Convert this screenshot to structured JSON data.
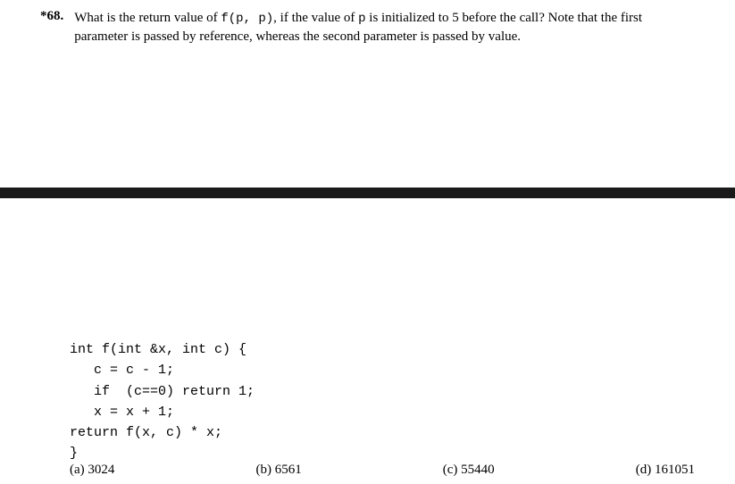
{
  "question": {
    "number": "*68.",
    "text_part1": "What is the return value of ",
    "code1": "f(p, p)",
    "text_part2": ", if the value of ",
    "code2": "p",
    "text_part3": " is initialized to 5 before the call? Note that the first parameter is passed by reference, whereas the second parameter is passed by value."
  },
  "code": {
    "line1": "int f(int &x, int c) {",
    "line2": "   c = c - 1;",
    "line3": "   if  (c==0) return 1;",
    "line4": "   x = x + 1;",
    "line5": "return f(x, c) * x;",
    "line6": "}"
  },
  "options": {
    "a": "(a)  3024",
    "b": "(b)  6561",
    "c": "(c)  55440",
    "d": "(d)  161051"
  }
}
